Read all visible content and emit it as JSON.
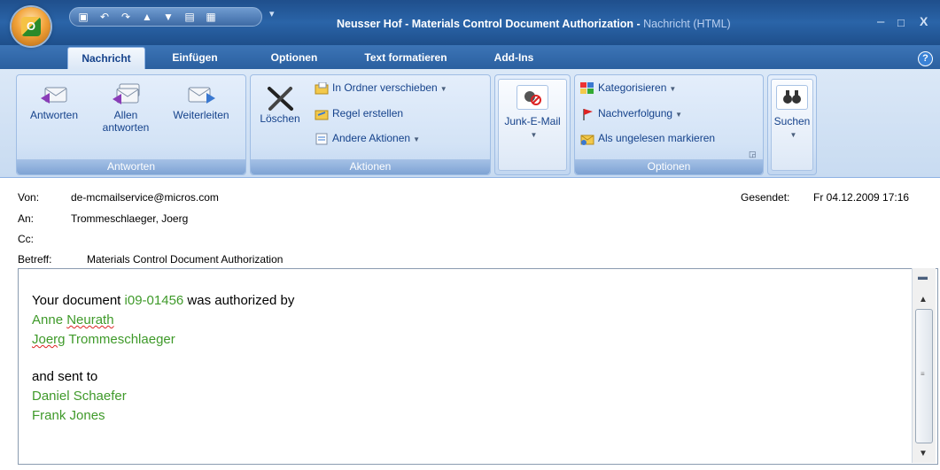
{
  "window": {
    "title_main": "Neusser Hof - Materials Control Document Authorization - ",
    "title_sub": "Nachricht (HTML)",
    "orb_letter": "O",
    "controls": {
      "minimize": "–",
      "maximize": "□",
      "close": "X"
    }
  },
  "qat": {
    "icons": [
      "save-icon",
      "undo-icon",
      "redo-icon",
      "up-arrow-icon",
      "down-arrow-icon",
      "copy-icon",
      "print-icon"
    ]
  },
  "tabs": [
    {
      "label": "Nachricht",
      "active": true
    },
    {
      "label": "Einfügen"
    },
    {
      "label": "Optionen"
    },
    {
      "label": "Text formatieren"
    },
    {
      "label": "Add-Ins"
    }
  ],
  "help": "?",
  "ribbon": {
    "antworten": {
      "label": "Antworten",
      "reply": "Antworten",
      "reply_all_1": "Allen",
      "reply_all_2": "antworten",
      "forward": "Weiterleiten"
    },
    "aktionen": {
      "label": "Aktionen",
      "delete": "Löschen",
      "move": "In Ordner verschieben",
      "rule": "Regel erstellen",
      "other": "Andere Aktionen"
    },
    "junk": {
      "label": "Junk-E-Mail"
    },
    "optionen": {
      "label": "Optionen",
      "categorize": "Kategorisieren",
      "followup": "Nachverfolgung",
      "unread": "Als ungelesen markieren"
    },
    "suchen": {
      "label": "Suchen"
    }
  },
  "header": {
    "from_label": "Von:",
    "from_value": "de-mcmailservice@micros.com",
    "to_label": "An:",
    "to_value": "Trommeschlaeger, Joerg",
    "cc_label": "Cc:",
    "cc_value": "",
    "subject_label": "Betreff:",
    "subject_value": "Materials Control Document Authorization",
    "sent_label": "Gesendet:",
    "sent_value": "Fr 04.12.2009 17:16"
  },
  "body": {
    "line1_pre": "Your document ",
    "doc_number": "i09-01456",
    "line1_post": " was authorized by",
    "authorizer1_first": "Anne ",
    "authorizer1_last": "Neurath",
    "authorizer2_first": "Joerg",
    "authorizer2_last": " Trommeschlaeger",
    "sent_to": "and sent to",
    "recipient1": "Daniel Schaefer",
    "recipient2": "Frank Jones"
  },
  "colors": {
    "link_green": "#3f9a2a",
    "ribbon_text": "#15428b",
    "title_bar": "#2a64a8"
  }
}
